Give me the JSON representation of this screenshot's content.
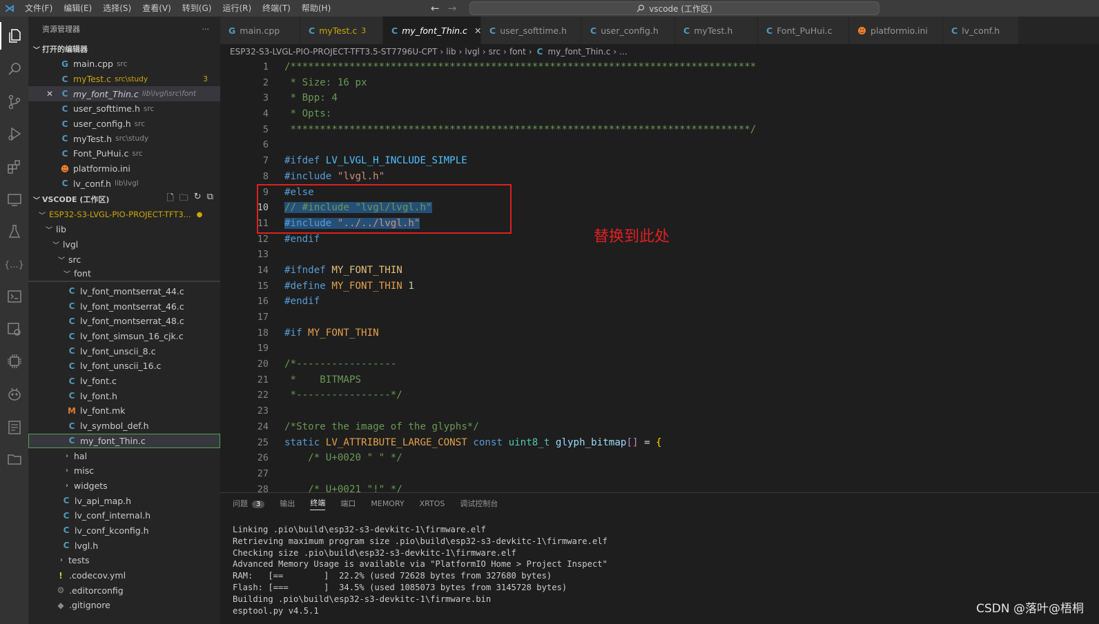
{
  "menu": [
    "文件(F)",
    "编辑(E)",
    "选择(S)",
    "查看(V)",
    "转到(G)",
    "运行(R)",
    "终端(T)",
    "帮助(H)"
  ],
  "command_center": "vscode (工作区)",
  "sidebar": {
    "title": "资源管理器",
    "open_editors_title": "打开的编辑器",
    "open_editors": [
      {
        "icon": "G",
        "name": "main.cpp",
        "path": "src"
      },
      {
        "icon": "C",
        "name": "myTest.c",
        "path": "src\\study",
        "badge": "3"
      },
      {
        "icon": "C",
        "name": "my_font_Thin.c",
        "path": "lib\\lvgl\\src\\font"
      },
      {
        "icon": "C",
        "name": "user_softtime.h",
        "path": "src"
      },
      {
        "icon": "C",
        "name": "user_config.h",
        "path": "src"
      },
      {
        "icon": "C",
        "name": "myTest.h",
        "path": "src\\study"
      },
      {
        "icon": "C",
        "name": "Font_PuHui.c",
        "path": "src"
      },
      {
        "icon": "P",
        "name": "platformio.ini",
        "path": ""
      },
      {
        "icon": "C",
        "name": "lv_conf.h",
        "path": "lib\\lvgl"
      }
    ],
    "workspace_title": "VSCODE (工作区)",
    "project": "ESP32-S3-LVGL-PIO-PROJECT-TFT3...",
    "tree": {
      "lib": "lib",
      "lvgl": "lvgl",
      "src": "src",
      "font": "font",
      "font_files": [
        {
          "icon": "C",
          "name": "lv_font_montserrat_44.c"
        },
        {
          "icon": "C",
          "name": "lv_font_montserrat_46.c"
        },
        {
          "icon": "C",
          "name": "lv_font_montserrat_48.c"
        },
        {
          "icon": "C",
          "name": "lv_font_simsun_16_cjk.c"
        },
        {
          "icon": "C",
          "name": "lv_font_unscii_8.c"
        },
        {
          "icon": "C",
          "name": "lv_font_unscii_16.c"
        },
        {
          "icon": "C",
          "name": "lv_font.c"
        },
        {
          "icon": "C",
          "name": "lv_font.h"
        },
        {
          "icon": "M",
          "name": "lv_font.mk"
        },
        {
          "icon": "C",
          "name": "lv_symbol_def.h"
        },
        {
          "icon": "C",
          "name": "my_font_Thin.c"
        }
      ],
      "src_folders": [
        "hal",
        "misc",
        "widgets"
      ],
      "lvgl_files": [
        "lv_api_map.h",
        "lv_conf_internal.h",
        "lv_conf_kconfig.h",
        "lvgl.h"
      ],
      "tests": "tests",
      "root_files": [
        {
          "icon": "!",
          "name": ".codecov.yml"
        },
        {
          "icon": "⚙",
          "name": ".editorconfig"
        },
        {
          "icon": "◆",
          "name": ".gitignore"
        }
      ]
    }
  },
  "tabs": [
    {
      "icon": "G",
      "label": "main.cpp"
    },
    {
      "icon": "C",
      "label": "myTest.c",
      "badge": "3"
    },
    {
      "icon": "C",
      "label": "my_font_Thin.c",
      "active": true
    },
    {
      "icon": "C",
      "label": "user_softtime.h"
    },
    {
      "icon": "C",
      "label": "user_config.h"
    },
    {
      "icon": "C",
      "label": "myTest.h"
    },
    {
      "icon": "C",
      "label": "Font_PuHui.c"
    },
    {
      "icon": "P",
      "label": "platformio.ini"
    },
    {
      "icon": "C",
      "label": "lv_conf.h"
    }
  ],
  "breadcrumb": [
    "ESP32-S3-LVGL-PIO-PROJECT-TFT3.5-ST7796U-CPT",
    "lib",
    "lvgl",
    "src",
    "font",
    "my_font_Thin.c",
    "..."
  ],
  "line_numbers": [
    "1",
    "2",
    "3",
    "4",
    "5",
    "6",
    "7",
    "8",
    "9",
    "10",
    "11",
    "12",
    "13",
    "14",
    "15",
    "16",
    "17",
    "18",
    "19",
    "20",
    "21",
    "22",
    "23",
    "24",
    "25",
    "26",
    "27",
    "28"
  ],
  "code": {
    "l1": "/*******************************************************************************",
    "l2": " * Size: 16 px",
    "l3": " * Bpp: 4",
    "l4": " * Opts:",
    "l5": " ******************************************************************************/",
    "l7a": "#ifdef",
    "l7b": " LV_LVGL_H_INCLUDE_SIMPLE",
    "l8a": "#include",
    "l8b": "\"lvgl.h\"",
    "l9": "#else",
    "l10": "// #include \"lvgl/lvgl.h\"",
    "l11a": "#include",
    "l11b": "\"../../lvgl.h\"",
    "l12": "#endif",
    "l14a": "#ifndef",
    "l14b": " MY_FONT_THIN",
    "l15a": "#define",
    "l15b": " MY_FONT_THIN",
    "l15c": " 1",
    "l16": "#endif",
    "l18a": "#if",
    "l18b": " MY_FONT_THIN",
    "l20": "/*-----------------",
    "l21": " *    BITMAPS",
    "l22": " *----------------*/",
    "l24": "/*Store the image of the glyphs*/",
    "l25a": "static",
    "l25b": " LV_ATTRIBUTE_LARGE_CONST",
    "l25c": " const",
    "l25d": " uint8_t",
    "l25e": " glyph_bitmap",
    "l25f": "[]",
    "l25g": " = ",
    "l25h": "{",
    "l26": "    /* U+0020 \" \" */",
    "l28": "    /* U+0021 \"!\" */"
  },
  "annotation": "替换到此处",
  "panel": {
    "tabs": [
      "问题",
      "输出",
      "终端",
      "端口",
      "MEMORY",
      "XRTOS",
      "调试控制台"
    ],
    "problems_count": "3",
    "terminal": [
      "Linking .pio\\build\\esp32-s3-devkitc-1\\firmware.elf",
      "Retrieving maximum program size .pio\\build\\esp32-s3-devkitc-1\\firmware.elf",
      "Checking size .pio\\build\\esp32-s3-devkitc-1\\firmware.elf",
      "Advanced Memory Usage is available via \"PlatformIO Home > Project Inspect\"",
      "RAM:   [==        ]  22.2% (used 72628 bytes from 327680 bytes)",
      "Flash: [===       ]  34.5% (used 1085073 bytes from 3145728 bytes)",
      "Building .pio\\build\\esp32-s3-devkitc-1\\firmware.bin",
      "esptool.py v4.5.1"
    ]
  },
  "watermark": "CSDN @落叶@梧桐"
}
